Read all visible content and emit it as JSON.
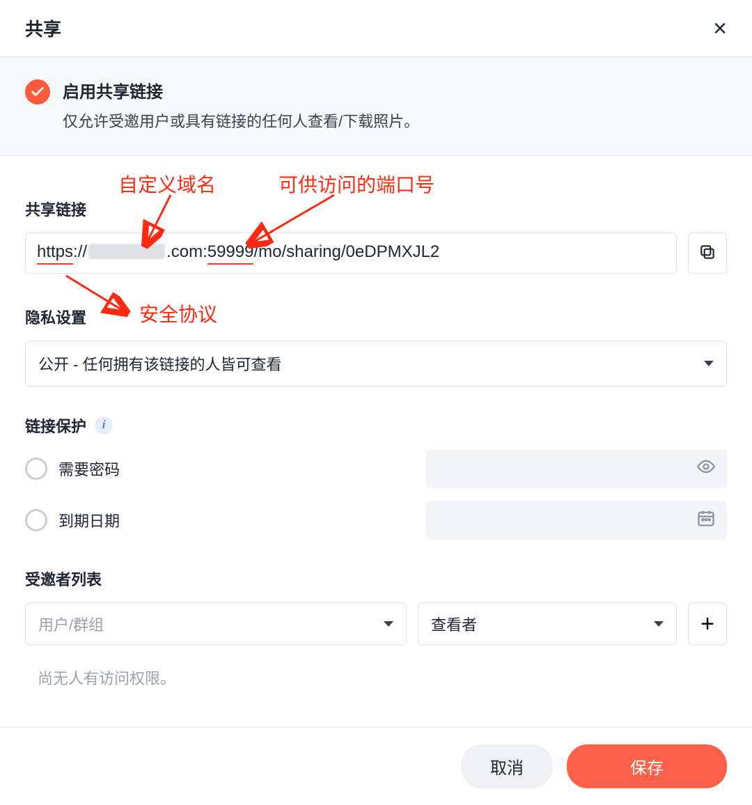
{
  "header": {
    "title": "共享"
  },
  "enable": {
    "title": "启用共享链接",
    "desc": "仅允许受邀用户或具有链接的任何人查看/下载照片。"
  },
  "labels": {
    "share_link": "共享链接",
    "privacy": "隐私设置",
    "link_protect": "链接保护",
    "invitees": "受邀者列表"
  },
  "url": {
    "scheme": "https",
    "sep1": "://",
    "tld": ".com",
    "sep2": ":",
    "port": "59999",
    "path": "/mo/sharing/0eDPMXJL2"
  },
  "privacy_select": {
    "value": "公开 - 任何拥有该链接的人皆可查看"
  },
  "protect": {
    "password_label": "需要密码",
    "expiry_label": "到期日期"
  },
  "invite": {
    "user_placeholder": "用户/群组",
    "role_value": "查看者",
    "empty": "尚无人有访问权限。"
  },
  "footer": {
    "cancel": "取消",
    "save": "保存"
  },
  "annotations": {
    "domain": "自定义域名",
    "port": "可供访问的端口号",
    "scheme": "安全协议"
  }
}
